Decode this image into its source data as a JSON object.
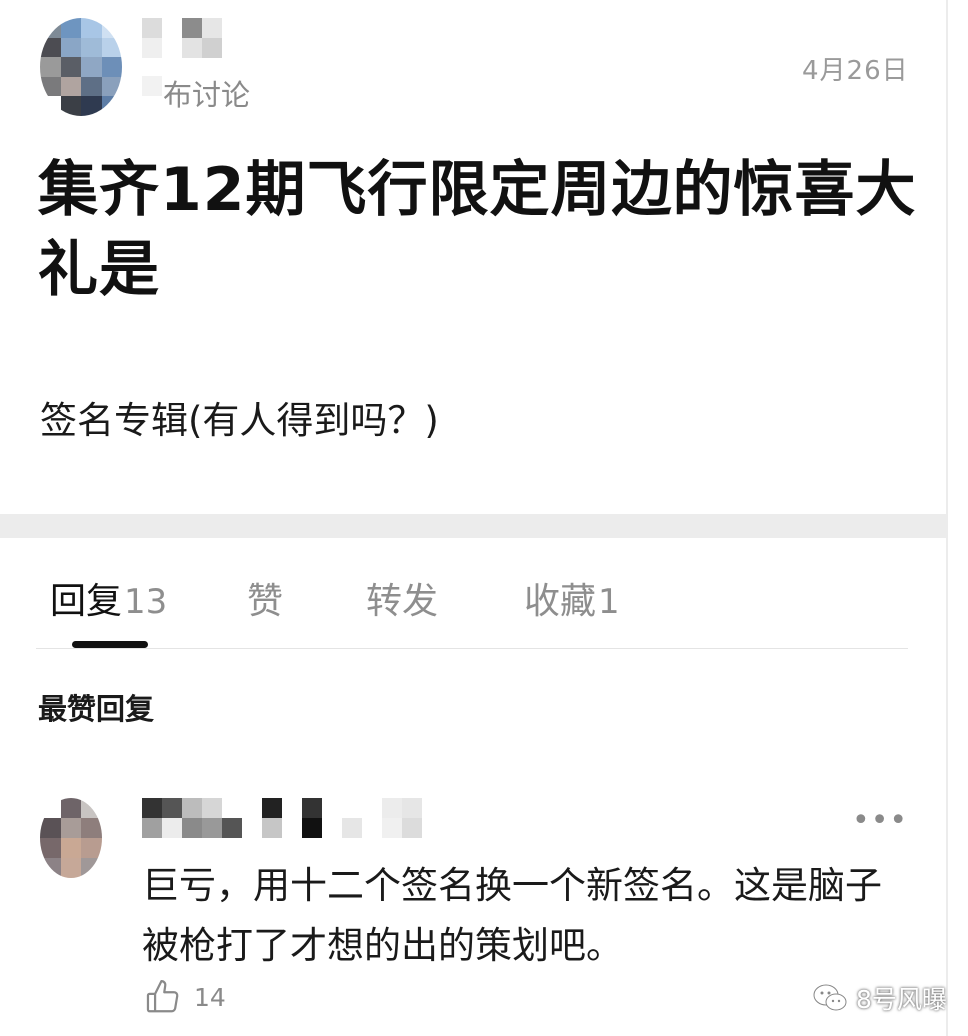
{
  "post": {
    "author_visible_suffix": "布讨论",
    "date": "4月26日",
    "title": "集齐12期飞行限定周边的惊喜大礼是",
    "body": "签名专辑(有人得到吗？)"
  },
  "tabs": [
    {
      "label": "回复",
      "count": "13",
      "active": true
    },
    {
      "label": "赞",
      "count": "",
      "active": false
    },
    {
      "label": "转发",
      "count": "",
      "active": false
    },
    {
      "label": "收藏",
      "count": "1",
      "active": false
    }
  ],
  "section_title": "最赞回复",
  "comment": {
    "text": "巨亏，用十二个签名换一个新签名。这是脑子被枪打了才想的出的策划吧。",
    "likes": "14",
    "more_icon": "more-dots-icon",
    "like_icon": "thumbs-up-icon"
  },
  "watermark": {
    "text": "8号风曝",
    "icon": "wechat-icon"
  },
  "colors": {
    "primary_text": "#1a1a1a",
    "secondary_text": "#8e8e8e",
    "separator": "#ececec",
    "active_tab_indicator": "#111111"
  }
}
